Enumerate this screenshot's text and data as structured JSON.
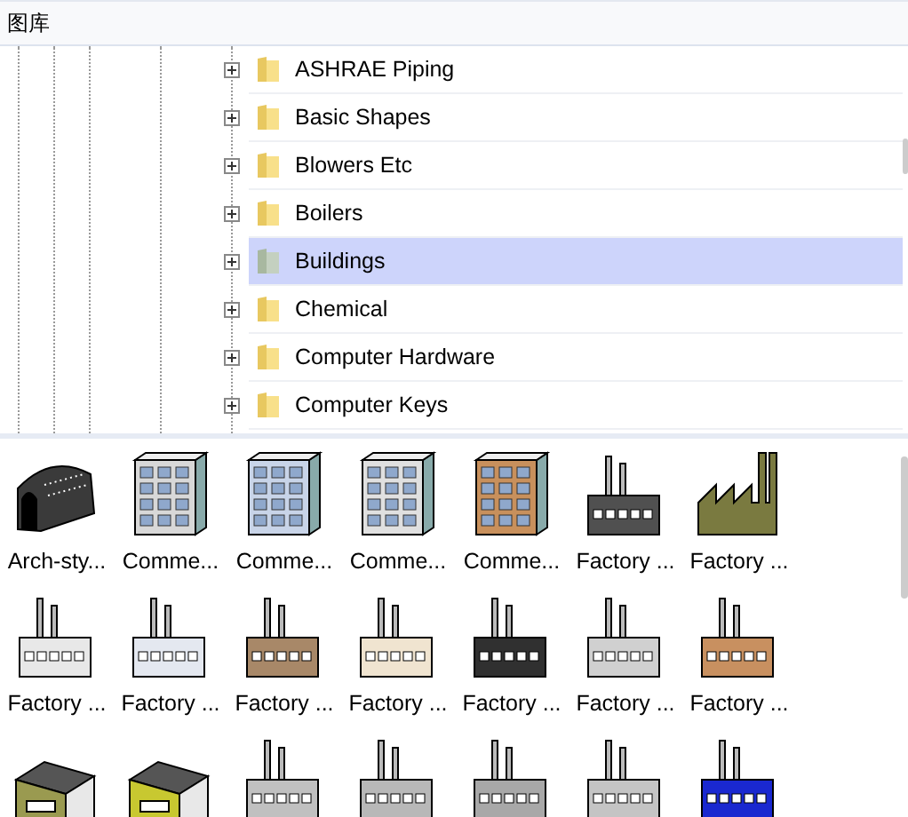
{
  "panel": {
    "title": "图库"
  },
  "tree": {
    "items": [
      {
        "label": "ASHRAE Piping",
        "selected": false
      },
      {
        "label": "Basic Shapes",
        "selected": false
      },
      {
        "label": "Blowers Etc",
        "selected": false
      },
      {
        "label": "Boilers",
        "selected": false
      },
      {
        "label": "Buildings",
        "selected": true
      },
      {
        "label": "Chemical",
        "selected": false
      },
      {
        "label": "Computer Hardware",
        "selected": false
      },
      {
        "label": "Computer Keys",
        "selected": false
      }
    ]
  },
  "gallery": {
    "items": [
      {
        "label": "Arch-sty...",
        "kind": "arch",
        "color": "#3a3a3a"
      },
      {
        "label": "Comme...",
        "kind": "tower",
        "color": "#d8d8d8"
      },
      {
        "label": "Comme...",
        "kind": "tower",
        "color": "#c8d4e8"
      },
      {
        "label": "Comme...",
        "kind": "tower",
        "color": "#e0e0e0"
      },
      {
        "label": "Comme...",
        "kind": "tower",
        "color": "#c8905c"
      },
      {
        "label": "Factory ...",
        "kind": "factory",
        "color": "#505050"
      },
      {
        "label": "Factory ...",
        "kind": "sawtooth",
        "color": "#7a7a40"
      },
      {
        "label": "Factory ...",
        "kind": "factory",
        "color": "#e8e8e8"
      },
      {
        "label": "Factory ...",
        "kind": "factory",
        "color": "#e4e8f0"
      },
      {
        "label": "Factory ...",
        "kind": "factory",
        "color": "#a88868"
      },
      {
        "label": "Factory ...",
        "kind": "factory",
        "color": "#f0e4d0"
      },
      {
        "label": "Factory ...",
        "kind": "factory",
        "color": "#303030"
      },
      {
        "label": "Factory ...",
        "kind": "factory",
        "color": "#d0d0d0"
      },
      {
        "label": "Factory ...",
        "kind": "factory",
        "color": "#c89060"
      },
      {
        "kind": "block",
        "color": "#9a9a50"
      },
      {
        "kind": "block",
        "color": "#c8c830"
      },
      {
        "kind": "factory",
        "color": "#c0c0c0"
      },
      {
        "kind": "factory",
        "color": "#b8b8b8"
      },
      {
        "kind": "factory",
        "color": "#a8a8a8"
      },
      {
        "kind": "factory",
        "color": "#c4c4c4"
      },
      {
        "kind": "factory",
        "color": "#1a28d0"
      }
    ]
  }
}
